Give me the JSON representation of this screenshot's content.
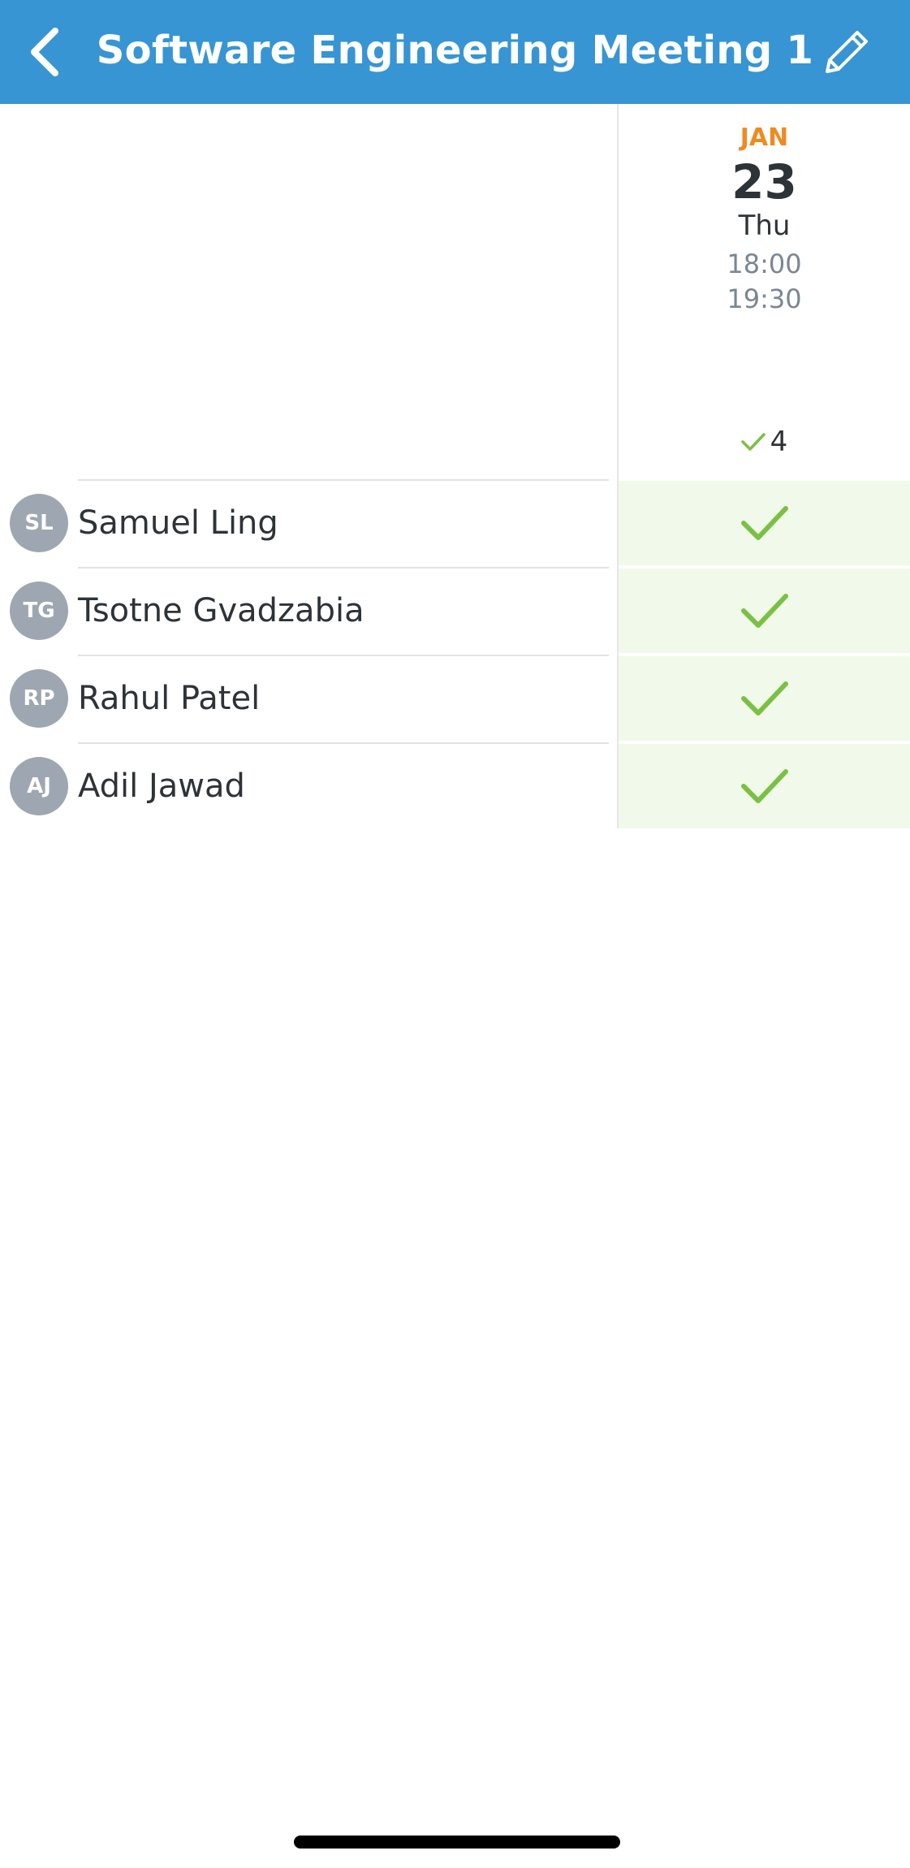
{
  "header": {
    "title": "Software Engineering Meeting 1",
    "background_color": "#3795d3",
    "back_icon": "chevron-left-icon",
    "edit_icon": "pencil-icon"
  },
  "date_option": {
    "month": "JAN",
    "day": "23",
    "weekday": "Thu",
    "start_time": "18:00",
    "end_time": "19:30",
    "yes_count": "4",
    "month_color": "#ef8a23"
  },
  "participants": [
    {
      "initials": "SL",
      "name": "Samuel Ling",
      "vote": "yes"
    },
    {
      "initials": "TG",
      "name": "Tsotne Gvadzabia",
      "vote": "yes"
    },
    {
      "initials": "RP",
      "name": "Rahul Patel",
      "vote": "yes"
    },
    {
      "initials": "AJ",
      "name": "Adil Jawad",
      "vote": "yes"
    }
  ],
  "colors": {
    "yes_check": "#7ac143",
    "yes_cell_background": "#f1f9eb",
    "avatar": "#9ea7b1"
  }
}
